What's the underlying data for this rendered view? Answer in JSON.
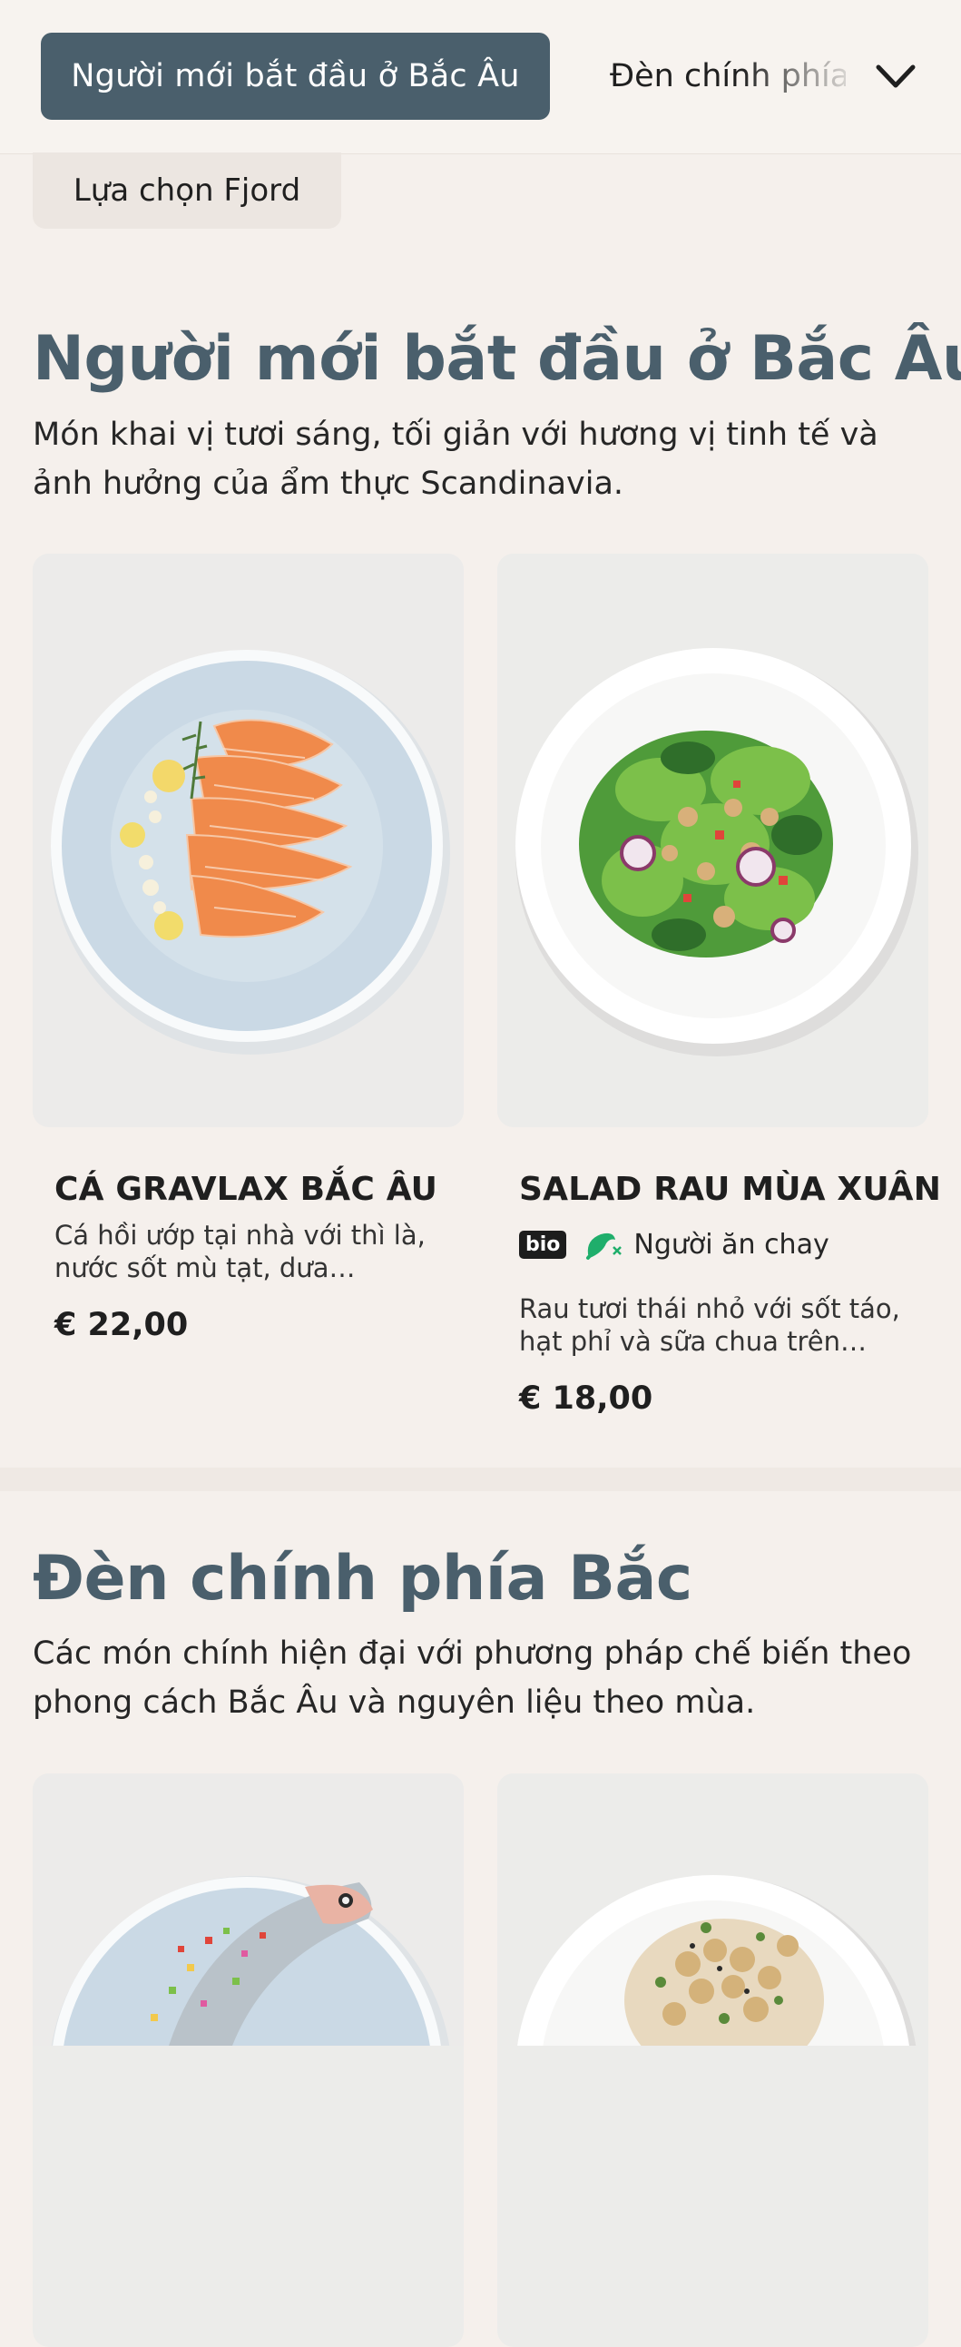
{
  "nav": {
    "active_tab": "Người mới bắt đầu ở Bắc Âu",
    "next_tab": "Đèn chính phía Bắc",
    "sub_tab": "Lựa chọn Fjord",
    "chevron_icon": "chevron-down-icon"
  },
  "sections": [
    {
      "title": "Người mới bắt đầu ở Bắc Âu",
      "description": "Món khai vị tươi sáng, tối giản với hương vị tinh tế và ảnh hưởng của ẩm thực Scandinavia.",
      "items": [
        {
          "name": "CÁ GRAVLAX BẮC ÂU",
          "description": "Cá hồi ướp tại nhà với thì là, nước sốt mù tạt, dưa chuột...",
          "price": "€ 22,00",
          "image_icon": "salmon-plate-image",
          "plate_color": "#c9d8e4"
        },
        {
          "name": "SALAD RAU MÙA XUÂN",
          "badge": "bio",
          "diet_label": "Người ăn chay",
          "diet_icon": "vegetarian-icon",
          "description": "Rau tươi thái nhỏ với sốt táo, hạt phỉ và sữa chua trên mộ...",
          "price": "€ 18,00",
          "image_icon": "salad-plate-image",
          "plate_color": "#ffffff"
        }
      ]
    },
    {
      "title": "Đèn chính phía Bắc",
      "description": "Các món chính hiện đại với phương pháp chế biến theo phong cách Bắc Âu và nguyên liệu theo mùa.",
      "items": [
        {
          "image_icon": "fish-plate-image",
          "plate_color": "#c9d8e4"
        },
        {
          "image_icon": "chicken-plate-image",
          "plate_color": "#ffffff"
        }
      ]
    }
  ],
  "colors": {
    "accent": "#4a5f6c",
    "background": "#f5f0ec",
    "vegetarian_green": "#1fae6b"
  }
}
